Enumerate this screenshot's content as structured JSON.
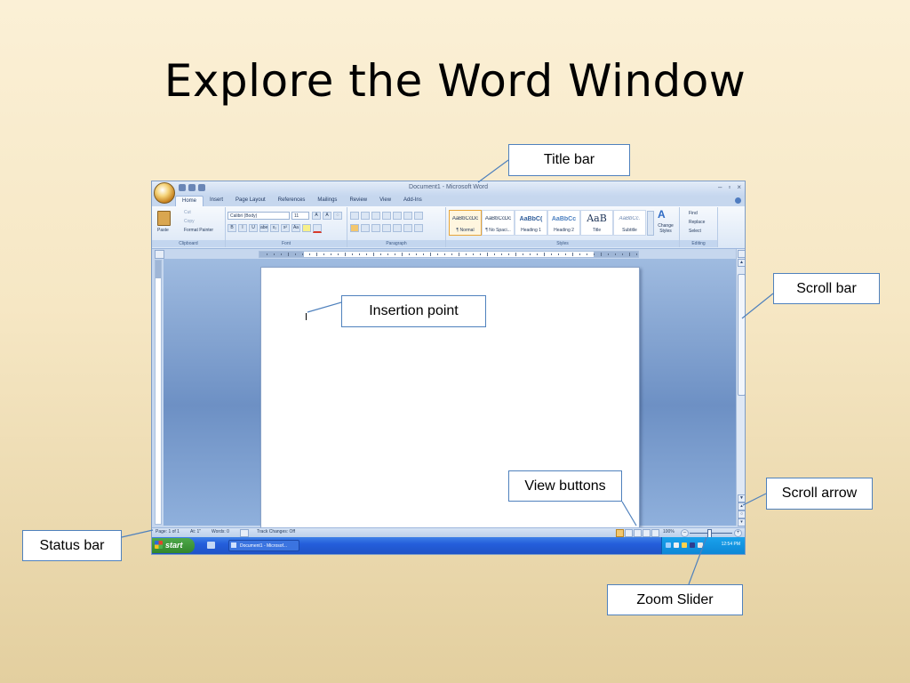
{
  "slide": {
    "title": "Explore the Word Window"
  },
  "callouts": {
    "title_bar": "Title bar",
    "insertion_point": "Insertion point",
    "scroll_bar": "Scroll bar",
    "view_buttons": "View buttons",
    "scroll_arrow": "Scroll arrow",
    "status_bar": "Status bar",
    "zoom_slider": "Zoom Slider"
  },
  "word": {
    "title": "Document1 - Microsoft Word",
    "window_controls": [
      "–",
      "▫",
      "×"
    ],
    "tabs": [
      {
        "label": "Home",
        "active": true
      },
      {
        "label": "Insert"
      },
      {
        "label": "Page Layout"
      },
      {
        "label": "References"
      },
      {
        "label": "Mailings"
      },
      {
        "label": "Review"
      },
      {
        "label": "View"
      },
      {
        "label": "Add-Ins"
      }
    ],
    "clipboard": {
      "paste": "Paste",
      "cut": "Cut",
      "copy": "Copy",
      "format_painter": "Format Painter",
      "group": "Clipboard"
    },
    "font": {
      "name": "Calibri (Body)",
      "size": "11",
      "group": "Font",
      "buttons": [
        "B",
        "I",
        "U",
        "abe",
        "x₂",
        "x²",
        "Aa"
      ]
    },
    "paragraph": {
      "group": "Paragraph"
    },
    "styles": {
      "group": "Styles",
      "tiles": [
        {
          "sample": "AaBbCcDc",
          "name": "¶ Normal",
          "selected": true
        },
        {
          "sample": "AaBbCcDc",
          "name": "¶ No Spaci..."
        },
        {
          "sample": "AaBbC(",
          "name": "Heading 1"
        },
        {
          "sample": "AaBbCc",
          "name": "Heading 2"
        },
        {
          "sample": "AaB",
          "name": "Title"
        },
        {
          "sample": "AaBbCc.",
          "name": "Subtitle"
        }
      ],
      "change_styles": "Change Styles"
    },
    "editing": {
      "find": "Find",
      "replace": "Replace",
      "select": "Select",
      "group": "Editing"
    },
    "status": {
      "page": "Page: 1 of 1",
      "at": "At: 1\"",
      "words": "Words: 0",
      "track_changes": "Track Changes: Off",
      "zoom": "100%"
    },
    "taskbar": {
      "start": "start",
      "task": "Document1 - Microsof...",
      "clock": "12:54 PM"
    }
  },
  "colors": {
    "callout_border": "#4f81bd",
    "ribbon_blue": "#c3d6ef",
    "taskbar_blue": "#245edb",
    "start_green": "#32862c"
  }
}
